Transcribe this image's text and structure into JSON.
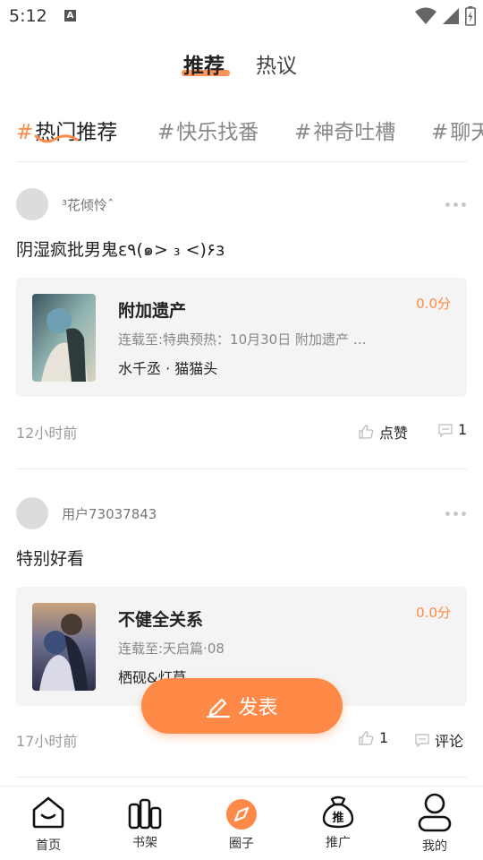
{
  "status_bar": {
    "time": "5:12",
    "notification_icon": "A"
  },
  "top_tabs": {
    "active": "推荐",
    "inactive": "热议"
  },
  "topics": [
    {
      "hash": "#",
      "label": "热门推荐"
    },
    {
      "hash": "#",
      "label": "快乐找番"
    },
    {
      "hash": "#",
      "label": "神奇吐槽"
    },
    {
      "hash": "#",
      "label": "聊天"
    }
  ],
  "posts": [
    {
      "username": "³花倾怜ˆ",
      "text": "阴湿疯批男鬼ε٩(๑> ₃ <)۶з",
      "book": {
        "title": "附加遗产",
        "score": "0.0分",
        "update": "连载至:特典预热：10月30日 附加遗产 …",
        "author": "水千丞 · 猫猫头"
      },
      "time": "12小时前",
      "like_label": "点赞",
      "comment_count": "1"
    },
    {
      "username": "用户73037843",
      "text": "特别好看",
      "book": {
        "title": "不健全关系",
        "score": "0.0分",
        "update": "连载至:天启篇·08",
        "author": "栖砚&灯草"
      },
      "time": "17小时前",
      "like_count": "1",
      "comment_label": "评论"
    }
  ],
  "publish": {
    "label": "发表"
  },
  "bottom_nav": [
    {
      "label": "首页",
      "icon": "home-icon"
    },
    {
      "label": "书架",
      "icon": "bookshelf-icon"
    },
    {
      "label": "圈子",
      "icon": "compass-icon"
    },
    {
      "label": "推广",
      "icon": "promo-bag-icon",
      "badge": "推"
    },
    {
      "label": "我的",
      "icon": "profile-icon"
    }
  ],
  "colors": {
    "accent": "#ff8a47",
    "card_bg": "#f4f4f4",
    "muted": "#999999"
  }
}
